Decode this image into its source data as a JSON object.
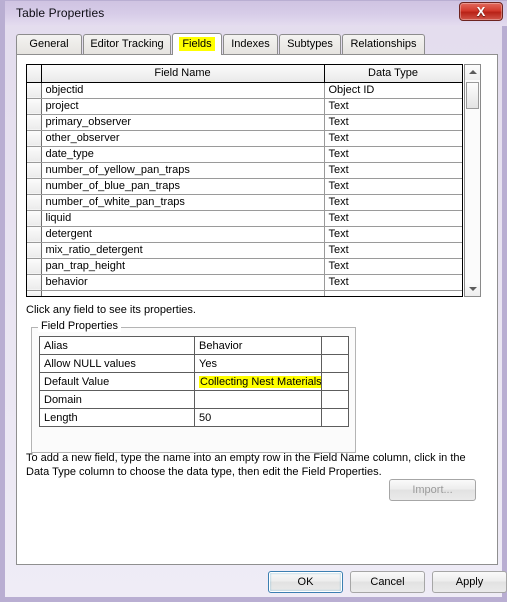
{
  "window": {
    "title": "Table Properties",
    "close_icon": "close-icon",
    "close_label": "X"
  },
  "tabs": [
    {
      "label": "General",
      "selected": false
    },
    {
      "label": "Editor Tracking",
      "selected": false
    },
    {
      "label": "Fields",
      "selected": true
    },
    {
      "label": "Indexes",
      "selected": false
    },
    {
      "label": "Subtypes",
      "selected": false
    },
    {
      "label": "Relationships",
      "selected": false
    }
  ],
  "grid": {
    "columns": [
      "Field Name",
      "Data Type"
    ],
    "rows": [
      {
        "name": "objectid",
        "type": "Object ID"
      },
      {
        "name": "project",
        "type": "Text"
      },
      {
        "name": "primary_observer",
        "type": "Text"
      },
      {
        "name": "other_observer",
        "type": "Text"
      },
      {
        "name": "date_type",
        "type": "Text"
      },
      {
        "name": "number_of_yellow_pan_traps",
        "type": "Text"
      },
      {
        "name": "number_of_blue_pan_traps",
        "type": "Text"
      },
      {
        "name": "number_of_white_pan_traps",
        "type": "Text"
      },
      {
        "name": "liquid",
        "type": "Text"
      },
      {
        "name": "detergent",
        "type": "Text"
      },
      {
        "name": "mix_ratio_detergent",
        "type": "Text"
      },
      {
        "name": "pan_trap_height",
        "type": "Text"
      },
      {
        "name": "behavior",
        "type": "Text"
      }
    ],
    "scrollbar": {
      "up_icon": "scroll-up-arrow-icon",
      "down_icon": "scroll-down-arrow-icon"
    }
  },
  "hint": "Click any field to see its properties.",
  "field_properties": {
    "group_label": "Field Properties",
    "rows": [
      {
        "key": "Alias",
        "value": "Behavior",
        "highlight": false
      },
      {
        "key": "Allow NULL values",
        "value": "Yes",
        "highlight": false
      },
      {
        "key": "Default Value",
        "value": "Collecting Nest Materials",
        "highlight": true
      },
      {
        "key": "Domain",
        "value": "",
        "highlight": false
      },
      {
        "key": "Length",
        "value": "50",
        "highlight": false
      }
    ],
    "highlight_color": "#ffff00"
  },
  "import_button": {
    "label": "Import...",
    "enabled": false
  },
  "instruction": "To add a new field, type the name into an empty row in the Field Name column, click in the Data Type column to choose the data type, then edit the Field Properties.",
  "footer": {
    "ok": "OK",
    "cancel": "Cancel",
    "apply": "Apply",
    "default_button": "OK",
    "focus_color": "#3c7fb1"
  }
}
